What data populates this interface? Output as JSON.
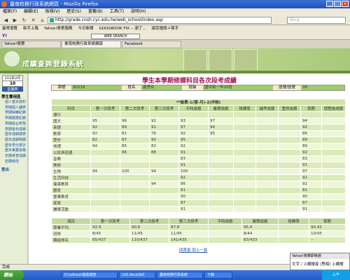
{
  "window": {
    "title": "臺南校務行政系統網頁 - Mozilla Firefox"
  },
  "menubar": [
    "檔案(F)",
    "編輯(E)",
    "檢視(V)",
    "歷史(S)",
    "書籤(B)",
    "工具(T)",
    "說明(H)"
  ],
  "navbar": {
    "url": "http://grade.cnsh.cyc.edu.tw/web_school/index.asp",
    "search_placeholder": "Bing"
  },
  "bookmarks": [
    "最常瀏覽",
    "新手上路",
    "Yahoo!奇摩服務",
    "今日新聞",
    "GOOGBOOK FIX -- 瀏了...",
    "接受邀請-f-幫手"
  ],
  "yahoobar": {
    "logo": "Y!",
    "web_search": "WEB SEARCH"
  },
  "tabs": [
    "Yahoo!奇摩",
    "臺南校務行政系統網頁",
    "Facebook"
  ],
  "banner": {
    "title": "成績查詢登錄系統"
  },
  "sidebar": {
    "calendar": {
      "month": "111年2月",
      "day": "10",
      "weekday": "星期四"
    },
    "section": "學生專用區",
    "items": [
      "個人基本資料",
      "學期個人課表",
      "學期缺曠紀錄",
      "學期獎懲紀錄",
      "學期綜合表現",
      "學期各科成績",
      "歷年成績總表",
      "歷年成績明細",
      "歷年學分累計",
      "歷年畢業資格",
      "定期考查成績",
      "密碼修改"
    ],
    "logout": "登出"
  },
  "page": {
    "title": "學生本學期修課科目各次段考成績",
    "info": [
      {
        "label": "學號",
        "value": "90218"
      },
      {
        "label": "姓名",
        "value": "盧思伶"
      },
      {
        "label": "班級",
        "value": "國中部一年05班"
      },
      {
        "label": "座號/座號",
        "value": "38"
      }
    ],
    "semester": "**該學-1(發-月)-2(作物)",
    "grade_headers": [
      "科目",
      "第一次段考",
      "第二次段考",
      "第三次段考",
      "平時成績",
      "暑期成績",
      "授課學",
      "補考成績",
      "重修成績",
      "學期",
      "調整後成績"
    ],
    "grade_rows": [
      [
        "德行",
        "",
        "",
        "",
        "",
        "",
        "",
        "",
        "",
        "",
        ""
      ],
      [
        "國文",
        "95",
        "96",
        "92",
        "93",
        "97",
        "",
        "",
        "",
        "94",
        ""
      ],
      [
        "英語",
        "92",
        "89",
        "91",
        "97",
        "94",
        "",
        "",
        "",
        "92",
        ""
      ],
      [
        "數學",
        "92",
        "81",
        "76",
        "92",
        "95",
        "",
        "",
        "",
        "86",
        ""
      ],
      [
        "歷史",
        "82",
        "87",
        "90",
        "95",
        "",
        "",
        "",
        "",
        "89",
        ""
      ],
      [
        "地理",
        "94",
        "85",
        "82",
        "92",
        "",
        "",
        "",
        "",
        "89",
        ""
      ],
      [
        "公民與道德",
        "",
        "96",
        "88",
        "91",
        "",
        "",
        "",
        "",
        "92",
        ""
      ],
      [
        "音樂",
        "",
        "",
        "",
        "83",
        "",
        "",
        "",
        "",
        "83",
        ""
      ],
      [
        "美術",
        "",
        "",
        "",
        "91",
        "",
        "",
        "",
        "",
        "91",
        ""
      ],
      [
        "生物",
        "94",
        "100",
        "94",
        "100",
        "",
        "",
        "",
        "",
        "97",
        ""
      ],
      [
        "生活科技",
        "",
        "",
        "",
        "92",
        "",
        "",
        "",
        "",
        "92",
        ""
      ],
      [
        "健康教育",
        "",
        "",
        "94",
        "86",
        "",
        "",
        "",
        "",
        "92",
        ""
      ],
      [
        "體育",
        "",
        "",
        "",
        "81",
        "",
        "",
        "",
        "",
        "81",
        ""
      ],
      [
        "童軍教育",
        "",
        "",
        "",
        "90",
        "",
        "",
        "",
        "",
        "90",
        ""
      ],
      [
        "家政",
        "",
        "",
        "",
        "87",
        "",
        "",
        "",
        "",
        "87",
        ""
      ],
      [
        "輔導活動",
        "",
        "",
        "",
        "91",
        "",
        "",
        "",
        "",
        "91",
        ""
      ]
    ],
    "summary_headers": [
      "項目",
      "第一次段考",
      "第二次段考",
      "第三次段考",
      "平時成績",
      "暑期成績",
      "授課學",
      "學期"
    ],
    "summary_rows": [
      [
        "學業平均",
        "92.9",
        "90.6",
        "87.8",
        "",
        "95.4",
        "",
        "90.42"
      ],
      [
        "班排",
        "8/45",
        "11/45",
        "11/45",
        "",
        "8/44",
        "",
        "10/45"
      ],
      [
        "類組排名",
        "65/437",
        "110/437",
        "141/435",
        "",
        "83/433",
        "",
        "--"
      ]
    ],
    "pager": [
      "回首頁",
      "回上一頁"
    ]
  },
  "status": {
    "text": "完成"
  },
  "taskbar": {
    "start": "開始",
    "buttons": [
      "D:\\sdhost\\檔案總管",
      "c10.deca3b0",
      "臺南校務行政系統",
      "下載"
    ],
    "clock": "上午"
  },
  "popup": {
    "header": "Yahoo!奇摩即時通",
    "body": "文字 / 上網搜尋 (思相) 上網搜"
  }
}
